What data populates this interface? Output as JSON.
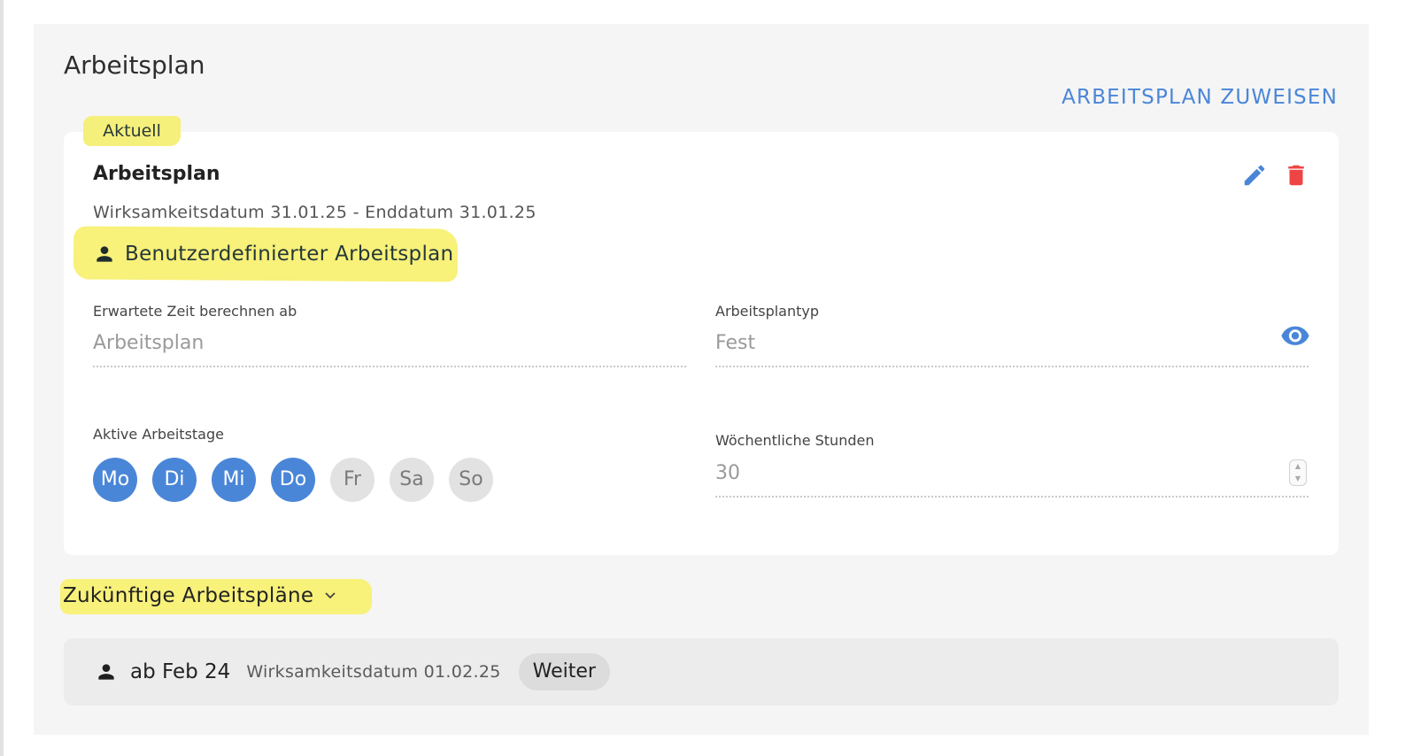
{
  "section": {
    "title": "Arbeitsplan",
    "assign_link": "ARBEITSPLAN ZUWEISEN"
  },
  "current": {
    "badge": "Aktuell",
    "title": "Arbeitsplan",
    "dates": "Wirksamkeitsdatum 31.01.25 - Enddatum 31.01.25",
    "plan_name": "Benutzerdefinierter Arbeitsplan",
    "fields": {
      "calc_label": "Erwartete Zeit berechnen ab",
      "calc_value": "Arbeitsplan",
      "type_label": "Arbeitsplantyp",
      "type_value": "Fest",
      "days_label": "Aktive Arbeitstage",
      "hours_label": "Wöchentliche Stunden",
      "hours_value": "30"
    },
    "days": [
      {
        "label": "Mo",
        "active": true
      },
      {
        "label": "Di",
        "active": true
      },
      {
        "label": "Mi",
        "active": true
      },
      {
        "label": "Do",
        "active": true
      },
      {
        "label": "Fr",
        "active": false
      },
      {
        "label": "Sa",
        "active": false
      },
      {
        "label": "So",
        "active": false
      }
    ]
  },
  "future": {
    "title": "Zukünftige Arbeitspläne",
    "items": [
      {
        "from": "ab Feb 24",
        "date": "Wirksamkeitsdatum 01.02.25",
        "button": "Weiter"
      }
    ]
  },
  "colors": {
    "accent": "#4a86d8",
    "delete": "#ef4444",
    "highlight": "#f8f17a",
    "day_active": "#4a86d8",
    "day_inactive": "#e2e2e2"
  },
  "icons": {
    "edit": "pencil-icon",
    "delete": "trash-icon",
    "view": "eye-icon",
    "person": "person-icon",
    "expand": "chevron-down-icon"
  }
}
